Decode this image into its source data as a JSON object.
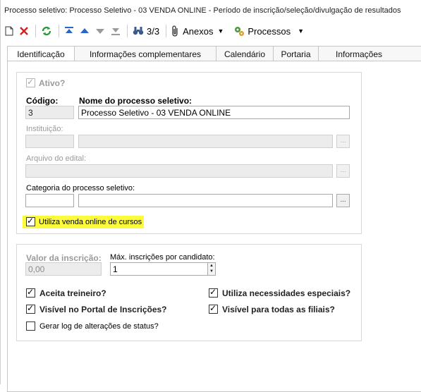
{
  "window": {
    "title": "Processo seletivo: Processo Seletivo - 03 VENDA ONLINE - Período de inscrição/seleção/divulgação de resultados"
  },
  "toolbar": {
    "record_counter": "3/3",
    "attachments_label": "Anexos",
    "processes_label": "Processos"
  },
  "tabs": [
    {
      "label": "Identificação",
      "active": true
    },
    {
      "label": "Informações complementares"
    },
    {
      "label": "Calendário"
    },
    {
      "label": "Portaria"
    },
    {
      "label": "Informações financeiras"
    }
  ],
  "identification": {
    "ativo_label": "Ativo?",
    "ativo_checked": true,
    "codigo_label": "Código:",
    "codigo_value": "3",
    "nome_label": "Nome do processo seletivo:",
    "nome_value": "Processo Seletivo - 03 VENDA ONLINE",
    "instituicao_label": "Instituição:",
    "instituicao_code": "",
    "instituicao_name": "",
    "arquivo_label": "Arquivo do edital:",
    "arquivo_value": "",
    "categoria_label": "Categoria do processo seletivo:",
    "categoria_code": "",
    "categoria_name": "",
    "browse_label": "...",
    "venda_online_label": "Utiliza venda online de cursos",
    "venda_online_checked": true
  },
  "registration": {
    "valor_label": "Valor da inscrição:",
    "valor_value": "0,00",
    "max_label": "Máx. inscrições por candidato:",
    "max_value": "1",
    "treineiro_label": "Aceita treineiro?",
    "treineiro_checked": true,
    "necessidades_label": "Utiliza necessidades especiais?",
    "necessidades_checked": true,
    "portal_label": "Visível no Portal de Inscrições?",
    "portal_checked": true,
    "filiais_label": "Visível para todas as filiais?",
    "filiais_checked": true,
    "log_label": "Gerar log de alterações de status?",
    "log_checked": false
  },
  "colors": {
    "highlight": "#fbfb3c",
    "arrow_blue": "#2a66c9",
    "delete_red": "#d42020",
    "refresh_green": "#2b9a3b"
  }
}
